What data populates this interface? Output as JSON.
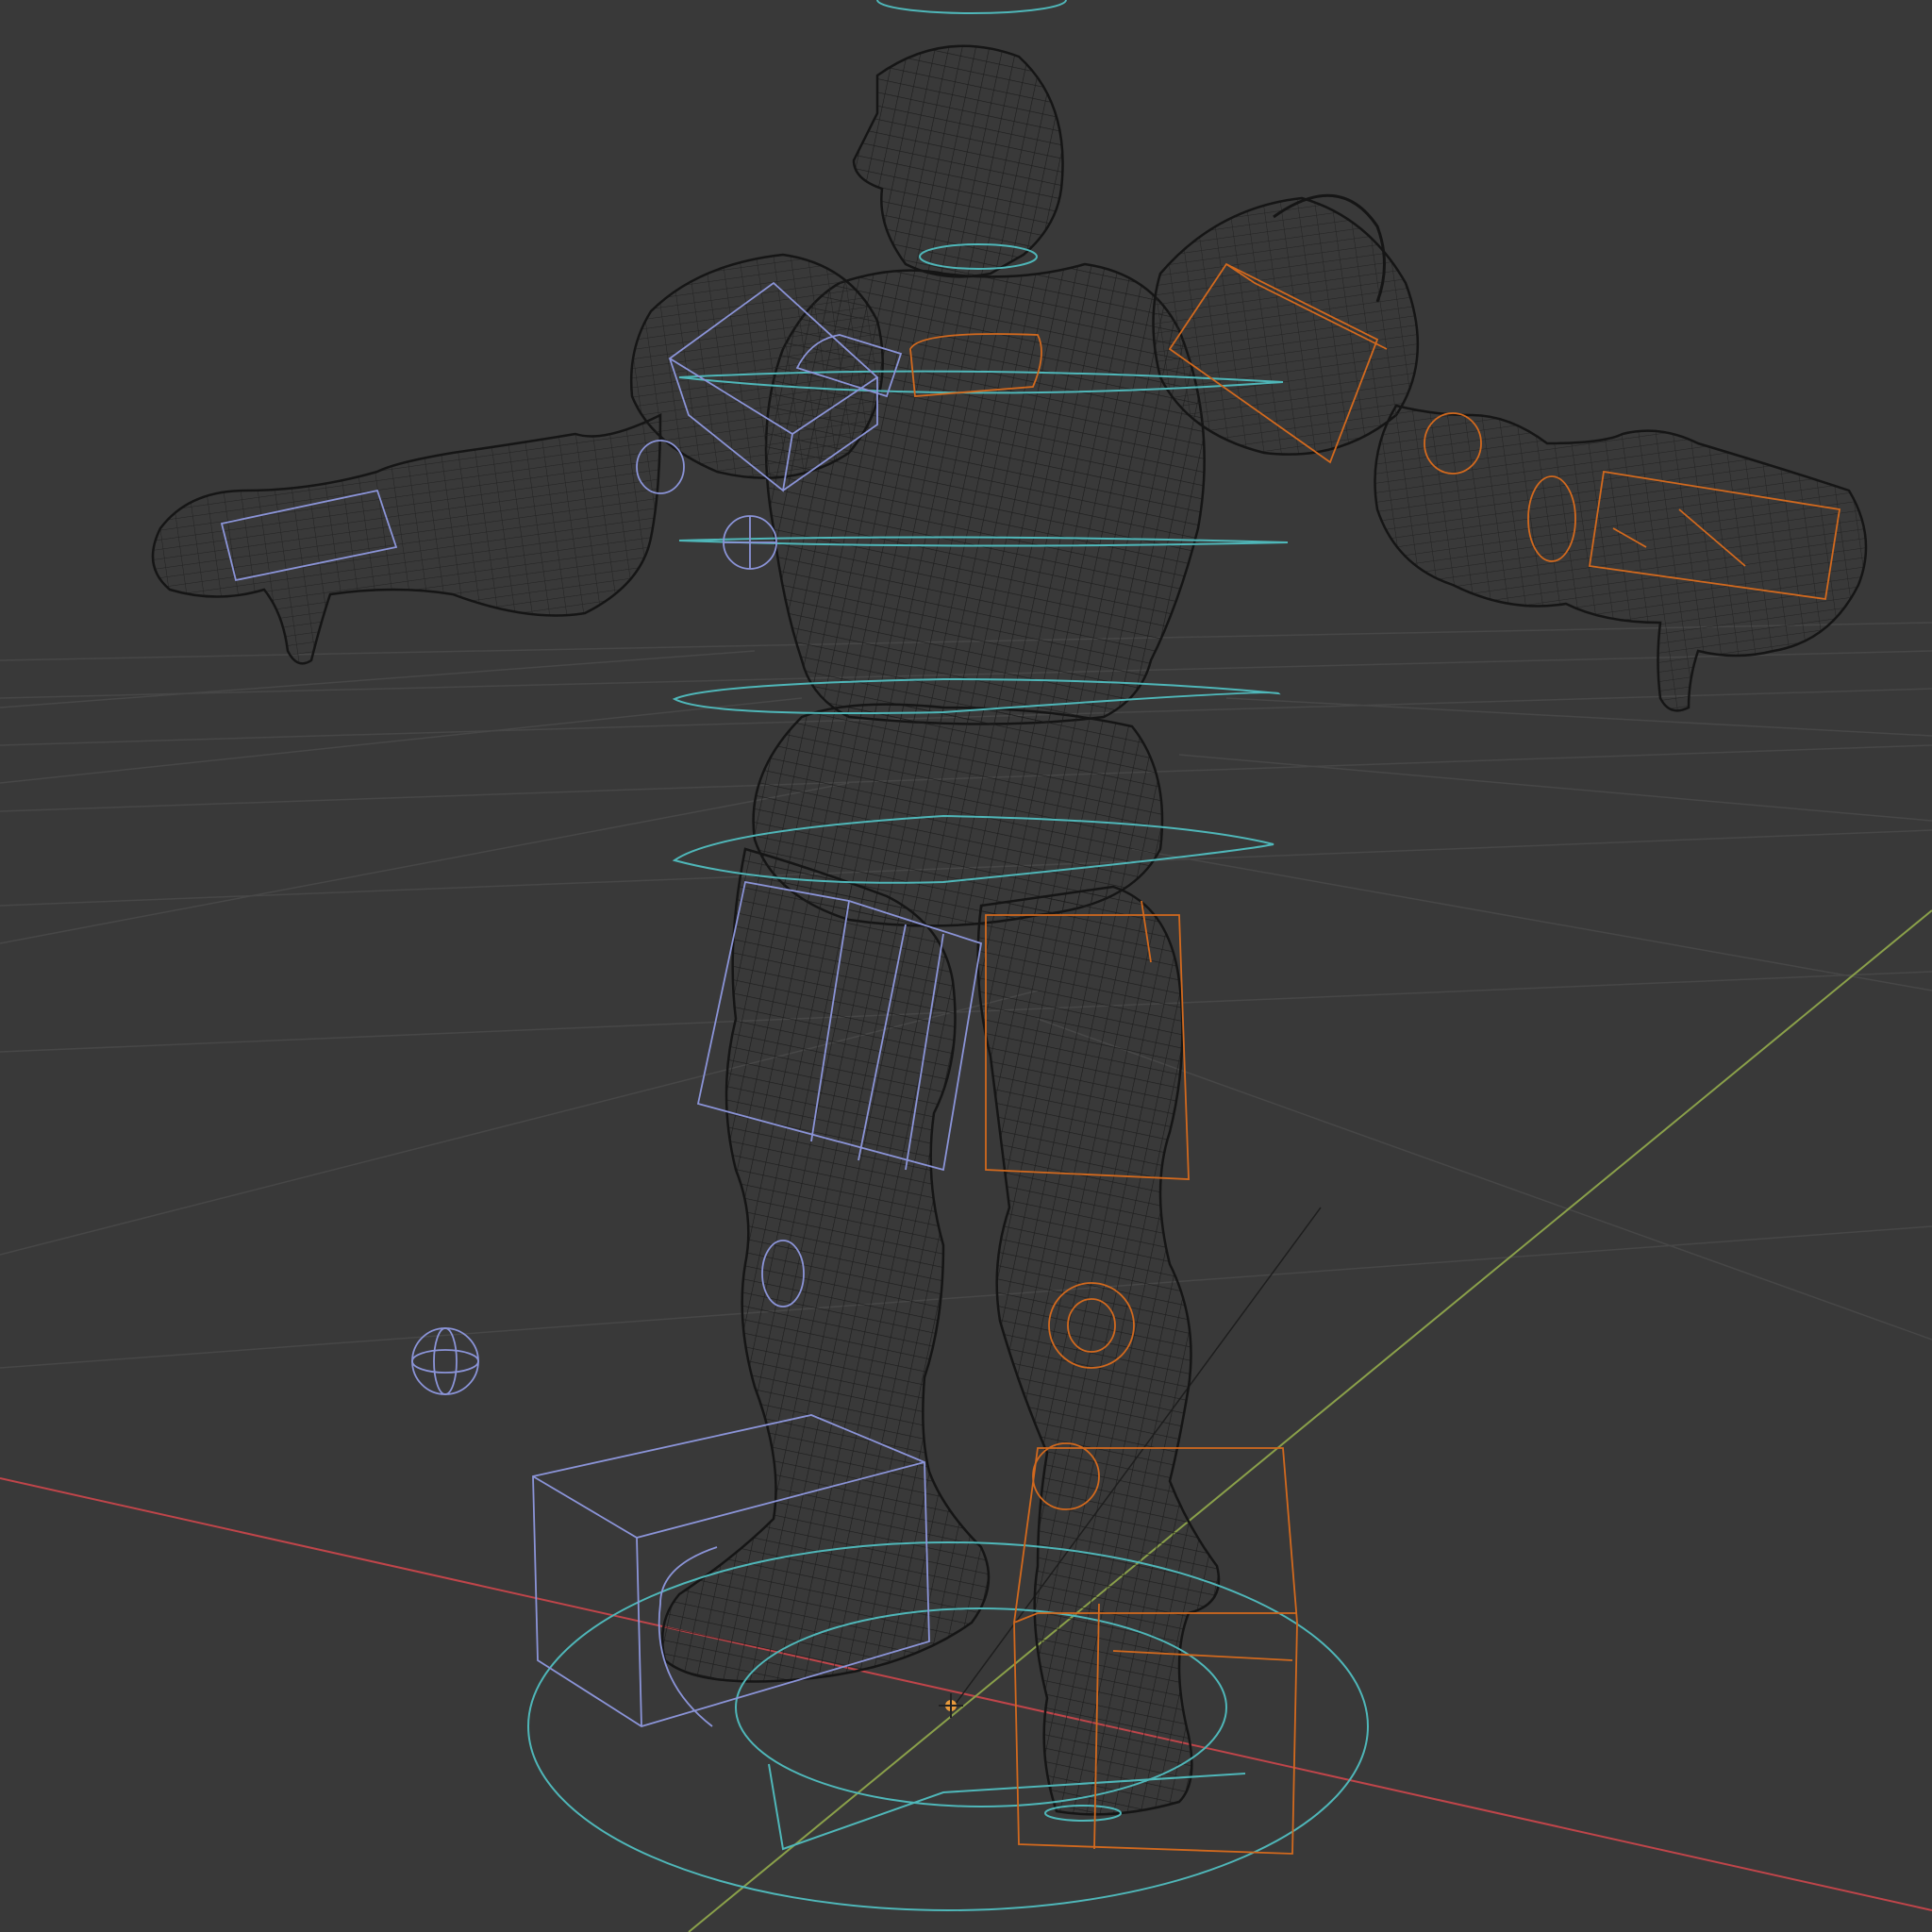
{
  "viewport": {
    "background": "#393939",
    "grid_color": "#4a4a4a",
    "x_axis_color": "#c0454a",
    "y_axis_color": "#8aa04a",
    "mesh_color": "#1a1a1a",
    "left_control_color": "#8b94d8",
    "right_control_color": "#d2691e",
    "center_control_color": "#4fb7b9",
    "origin_color": "#e89a3c"
  },
  "scene": {
    "mesh": "character-wireframe",
    "origin_marker": "3d-cursor-icon",
    "empty": "sphere-empty-icon"
  }
}
